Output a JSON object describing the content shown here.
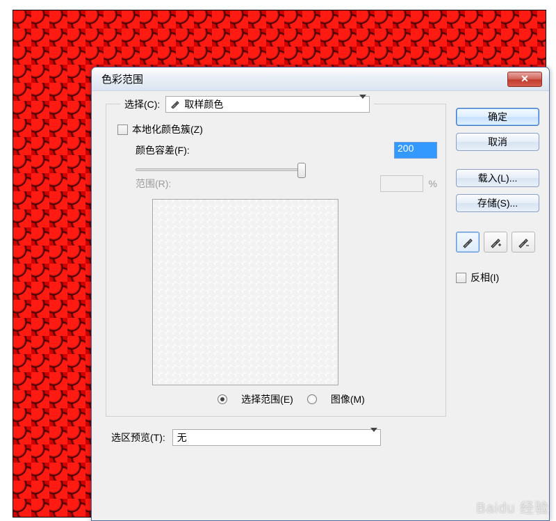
{
  "dialog": {
    "title": "色彩范围",
    "close_glyph": "✕"
  },
  "select": {
    "label": "选择(C):",
    "value": "取样颜色"
  },
  "localize_clusters": {
    "label": "本地化颜色簇(Z)"
  },
  "fuzziness": {
    "label": "颜色容差(F):",
    "value": "200"
  },
  "range": {
    "label": "范围(R):",
    "unit": "%"
  },
  "radios": {
    "selection": "选择范围(E)",
    "image": "图像(M)"
  },
  "selection_preview": {
    "label": "选区预览(T):",
    "value": "无"
  },
  "buttons": {
    "ok": "确定",
    "cancel": "取消",
    "load": "载入(L)...",
    "save": "存储(S)..."
  },
  "invert": {
    "label": "反相(I)"
  },
  "eyedroppers": {
    "sample": "eyedropper",
    "add": "eyedropper-plus",
    "subtract": "eyedropper-minus"
  },
  "watermark": "Baidu 经验"
}
